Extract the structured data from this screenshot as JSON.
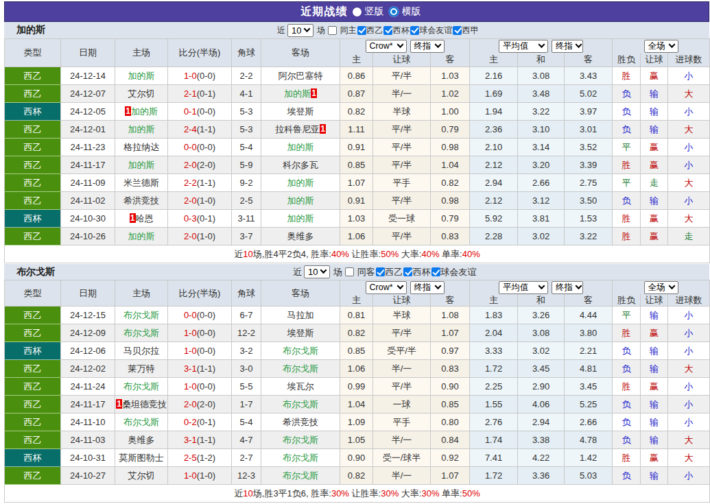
{
  "colors": {
    "purple": "#4e409e",
    "purple-border": "#2e2a66",
    "head-bg": "#dce3ec",
    "type-green": "#4a8f0e",
    "type-teal": "#086e69",
    "focus-green": "#2a9a43",
    "score-red": "#d40000",
    "res-red": "#bb0000",
    "res-blue": "#2424cc",
    "res-green": "#187a33",
    "card-red": "#e80000",
    "check-blue": "#0b79ec",
    "radio-blue": "#0e7ad8"
  },
  "title_bar": {
    "title": "近期战绩",
    "radios": [
      {
        "label": "竖版",
        "checked": false
      },
      {
        "label": "横版",
        "checked": true
      }
    ]
  },
  "table_header": {
    "left_columns": [
      "类型",
      "日期",
      "主场",
      "比分(半场)",
      "角球",
      "客场"
    ],
    "sub_columns": [
      "主",
      "让球",
      "客",
      "主",
      "和",
      "客",
      "胜负",
      "让球",
      "进球数"
    ],
    "selects": {
      "company": "Crow*",
      "company_final": "终指",
      "average": "平均值",
      "average_final": "终指",
      "full_match": "全场"
    }
  },
  "filter_labels": {
    "recent": "近",
    "count": "10",
    "matches": "场"
  },
  "sections": [
    {
      "team": "加的斯",
      "checkboxes": [
        {
          "label": "同主",
          "checked": false
        },
        {
          "label": "西乙",
          "checked": true
        },
        {
          "label": "西杯",
          "checked": true
        },
        {
          "label": "球会友谊",
          "checked": true
        },
        {
          "label": "西甲",
          "checked": true
        }
      ],
      "rows": [
        {
          "type": "西乙",
          "cup": false,
          "date": "24-12-14",
          "home": {
            "name": "加的斯",
            "focus": true
          },
          "ft": "1-0",
          "ht": "(0-0)",
          "corner": "2-2",
          "away": {
            "name": "阿尔巴塞特",
            "focus": false
          },
          "odds": [
            "0.86",
            "平/半",
            "1.03"
          ],
          "avg": [
            "2.16",
            "3.08",
            "3.43"
          ],
          "res": [
            {
              "t": "胜",
              "c": "r"
            },
            {
              "t": "赢",
              "c": "r"
            },
            {
              "t": "小",
              "c": "b"
            }
          ]
        },
        {
          "type": "西乙",
          "cup": false,
          "date": "24-12-07",
          "home": {
            "name": "艾尔切",
            "focus": false
          },
          "ft": "2-1",
          "ht": "(0-1)",
          "corner": "4-1",
          "away": {
            "name": "加的斯",
            "focus": true,
            "card": "1"
          },
          "odds": [
            "0.87",
            "半/一",
            "1.02"
          ],
          "avg": [
            "1.69",
            "3.48",
            "5.02"
          ],
          "res": [
            {
              "t": "负",
              "c": "b"
            },
            {
              "t": "输",
              "c": "b"
            },
            {
              "t": "大",
              "c": "r"
            }
          ]
        },
        {
          "type": "西杯",
          "cup": true,
          "date": "24-12-05",
          "home": {
            "name": "加的斯",
            "focus": true,
            "card": "1"
          },
          "ft": "0-1",
          "ht": "(0-0)",
          "corner": "5-3",
          "away": {
            "name": "埃登斯",
            "focus": false
          },
          "odds": [
            "0.82",
            "半球",
            "1.00"
          ],
          "avg": [
            "1.94",
            "3.22",
            "3.97"
          ],
          "res": [
            {
              "t": "负",
              "c": "b"
            },
            {
              "t": "输",
              "c": "b"
            },
            {
              "t": "小",
              "c": "b"
            }
          ]
        },
        {
          "type": "西乙",
          "cup": false,
          "date": "24-12-01",
          "home": {
            "name": "加的斯",
            "focus": true
          },
          "ft": "2-4",
          "ht": "(1-1)",
          "corner": "5-3",
          "away": {
            "name": "拉科鲁尼亚",
            "focus": false,
            "card": "1"
          },
          "odds": [
            "1.11",
            "平/半",
            "0.79"
          ],
          "avg": [
            "2.36",
            "3.10",
            "3.01"
          ],
          "res": [
            {
              "t": "负",
              "c": "b"
            },
            {
              "t": "输",
              "c": "b"
            },
            {
              "t": "大",
              "c": "r"
            }
          ]
        },
        {
          "type": "西乙",
          "cup": false,
          "date": "24-11-23",
          "home": {
            "name": "格拉纳达",
            "focus": false
          },
          "ft": "0-0",
          "ht": "(0-0)",
          "corner": "5-4",
          "away": {
            "name": "加的斯",
            "focus": true
          },
          "odds": [
            "0.91",
            "平/半",
            "0.98"
          ],
          "avg": [
            "2.10",
            "3.14",
            "3.52"
          ],
          "res": [
            {
              "t": "平",
              "c": "g"
            },
            {
              "t": "赢",
              "c": "r"
            },
            {
              "t": "小",
              "c": "b"
            }
          ]
        },
        {
          "type": "西乙",
          "cup": false,
          "date": "24-11-17",
          "home": {
            "name": "加的斯",
            "focus": true
          },
          "ft": "2-0",
          "ht": "(2-0)",
          "corner": "5-9",
          "away": {
            "name": "科尔多瓦",
            "focus": false
          },
          "odds": [
            "0.85",
            "平/半",
            "1.04"
          ],
          "avg": [
            "2.12",
            "3.20",
            "3.39"
          ],
          "res": [
            {
              "t": "胜",
              "c": "r"
            },
            {
              "t": "赢",
              "c": "r"
            },
            {
              "t": "小",
              "c": "b"
            }
          ]
        },
        {
          "type": "西乙",
          "cup": false,
          "date": "24-11-09",
          "home": {
            "name": "米兰德斯",
            "focus": false
          },
          "ft": "2-2",
          "ht": "(1-1)",
          "corner": "9-2",
          "away": {
            "name": "加的斯",
            "focus": true
          },
          "odds": [
            "1.07",
            "平手",
            "0.82"
          ],
          "avg": [
            "2.94",
            "2.66",
            "2.75"
          ],
          "res": [
            {
              "t": "平",
              "c": "g"
            },
            {
              "t": "走",
              "c": "g"
            },
            {
              "t": "大",
              "c": "r"
            }
          ]
        },
        {
          "type": "西乙",
          "cup": false,
          "date": "24-11-02",
          "home": {
            "name": "希洪竞技",
            "focus": false
          },
          "ft": "2-0",
          "ht": "(1-0)",
          "corner": "2-5",
          "away": {
            "name": "加的斯",
            "focus": true
          },
          "odds": [
            "0.91",
            "平/半",
            "0.98"
          ],
          "avg": [
            "2.12",
            "3.12",
            "3.50"
          ],
          "res": [
            {
              "t": "负",
              "c": "b"
            },
            {
              "t": "输",
              "c": "b"
            },
            {
              "t": "小",
              "c": "b"
            }
          ]
        },
        {
          "type": "西杯",
          "cup": true,
          "date": "24-10-30",
          "home": {
            "name": "哈恩",
            "focus": false,
            "card": "1"
          },
          "ft": "0-3",
          "ht": "(0-1)",
          "corner": "3-11",
          "away": {
            "name": "加的斯",
            "focus": true
          },
          "odds": [
            "1.03",
            "受一球",
            "0.79"
          ],
          "avg": [
            "5.92",
            "3.81",
            "1.53"
          ],
          "res": [
            {
              "t": "胜",
              "c": "r"
            },
            {
              "t": "赢",
              "c": "r"
            },
            {
              "t": "大",
              "c": "r"
            }
          ]
        },
        {
          "type": "西乙",
          "cup": false,
          "date": "24-10-26",
          "home": {
            "name": "加的斯",
            "focus": true
          },
          "ft": "2-0",
          "ht": "(1-0)",
          "corner": "3-7",
          "away": {
            "name": "奥维多",
            "focus": false
          },
          "odds": [
            "1.06",
            "平/半",
            "0.83"
          ],
          "avg": [
            "2.28",
            "3.02",
            "3.22"
          ],
          "res": [
            {
              "t": "胜",
              "c": "r"
            },
            {
              "t": "赢",
              "c": "r"
            },
            {
              "t": "走",
              "c": "g"
            }
          ]
        }
      ],
      "summary": [
        {
          "t": "近"
        },
        {
          "t": "10",
          "red": true
        },
        {
          "t": "场,胜4平2负4, 胜率:"
        },
        {
          "t": "40%",
          "red": true
        },
        {
          "t": " 让胜率:"
        },
        {
          "t": "50%",
          "red": true
        },
        {
          "t": " 大率:"
        },
        {
          "t": "40%",
          "red": true
        },
        {
          "t": " 单率:"
        },
        {
          "t": "40%",
          "red": true
        }
      ]
    },
    {
      "team": "布尔戈斯",
      "checkboxes": [
        {
          "label": "同客",
          "checked": false
        },
        {
          "label": "西乙",
          "checked": true
        },
        {
          "label": "西杯",
          "checked": true
        },
        {
          "label": "球会友谊",
          "checked": true
        }
      ],
      "rows": [
        {
          "type": "西乙",
          "cup": false,
          "date": "24-12-15",
          "home": {
            "name": "布尔戈斯",
            "focus": true
          },
          "ft": "0-0",
          "ht": "(0-0)",
          "corner": "6-7",
          "away": {
            "name": "马拉加",
            "focus": false
          },
          "odds": [
            "0.81",
            "半球",
            "1.08"
          ],
          "avg": [
            "1.83",
            "3.26",
            "4.44"
          ],
          "res": [
            {
              "t": "平",
              "c": "g"
            },
            {
              "t": "输",
              "c": "b"
            },
            {
              "t": "小",
              "c": "b"
            }
          ]
        },
        {
          "type": "西乙",
          "cup": false,
          "date": "24-12-09",
          "home": {
            "name": "布尔戈斯",
            "focus": true
          },
          "ft": "1-0",
          "ht": "(0-0)",
          "corner": "12-2",
          "away": {
            "name": "埃登斯",
            "focus": false
          },
          "odds": [
            "0.82",
            "平/半",
            "1.07"
          ],
          "avg": [
            "2.04",
            "3.08",
            "3.80"
          ],
          "res": [
            {
              "t": "胜",
              "c": "r"
            },
            {
              "t": "赢",
              "c": "r"
            },
            {
              "t": "小",
              "c": "b"
            }
          ]
        },
        {
          "type": "西杯",
          "cup": true,
          "date": "24-12-06",
          "home": {
            "name": "马贝尔拉",
            "focus": false
          },
          "ft": "1-0",
          "ht": "(0-0)",
          "corner": "3-2",
          "away": {
            "name": "布尔戈斯",
            "focus": true
          },
          "odds": [
            "0.85",
            "受平/半",
            "0.97"
          ],
          "avg": [
            "3.33",
            "3.02",
            "2.21"
          ],
          "res": [
            {
              "t": "负",
              "c": "b"
            },
            {
              "t": "输",
              "c": "b"
            },
            {
              "t": "小",
              "c": "b"
            }
          ]
        },
        {
          "type": "西乙",
          "cup": false,
          "date": "24-12-02",
          "home": {
            "name": "莱万特",
            "focus": false
          },
          "ft": "3-1",
          "ht": "(1-1)",
          "corner": "3-0",
          "away": {
            "name": "布尔戈斯",
            "focus": true
          },
          "odds": [
            "1.06",
            "半/一",
            "0.83"
          ],
          "avg": [
            "1.72",
            "3.45",
            "4.81"
          ],
          "res": [
            {
              "t": "负",
              "c": "b"
            },
            {
              "t": "输",
              "c": "b"
            },
            {
              "t": "大",
              "c": "r"
            }
          ]
        },
        {
          "type": "西乙",
          "cup": false,
          "date": "24-11-24",
          "home": {
            "name": "布尔戈斯",
            "focus": true
          },
          "ft": "1-0",
          "ht": "(0-0)",
          "corner": "5-5",
          "away": {
            "name": "埃瓦尔",
            "focus": false
          },
          "odds": [
            "0.99",
            "平/半",
            "0.90"
          ],
          "avg": [
            "2.25",
            "2.90",
            "3.45"
          ],
          "res": [
            {
              "t": "胜",
              "c": "r"
            },
            {
              "t": "赢",
              "c": "r"
            },
            {
              "t": "小",
              "c": "b"
            }
          ]
        },
        {
          "type": "西乙",
          "cup": false,
          "date": "24-11-17",
          "home": {
            "name": "桑坦德竞技",
            "focus": false,
            "card": "1"
          },
          "ft": "2-0",
          "ht": "(2-0)",
          "corner": "1-7",
          "away": {
            "name": "布尔戈斯",
            "focus": true
          },
          "odds": [
            "1.04",
            "一球",
            "0.85"
          ],
          "avg": [
            "1.55",
            "4.06",
            "5.25"
          ],
          "res": [
            {
              "t": "负",
              "c": "b"
            },
            {
              "t": "输",
              "c": "b"
            },
            {
              "t": "小",
              "c": "b"
            }
          ]
        },
        {
          "type": "西乙",
          "cup": false,
          "date": "24-11-10",
          "home": {
            "name": "布尔戈斯",
            "focus": true
          },
          "ft": "0-2",
          "ht": "(0-1)",
          "corner": "5-4",
          "away": {
            "name": "希洪竞技",
            "focus": false
          },
          "odds": [
            "1.09",
            "平手",
            "0.80"
          ],
          "avg": [
            "2.76",
            "2.94",
            "2.66"
          ],
          "res": [
            {
              "t": "负",
              "c": "b"
            },
            {
              "t": "输",
              "c": "b"
            },
            {
              "t": "小",
              "c": "b"
            }
          ]
        },
        {
          "type": "西乙",
          "cup": false,
          "date": "24-11-03",
          "home": {
            "name": "奥维多",
            "focus": false
          },
          "ft": "3-1",
          "ht": "(1-1)",
          "corner": "4-7",
          "away": {
            "name": "布尔戈斯",
            "focus": true
          },
          "odds": [
            "1.05",
            "半/一",
            "0.84"
          ],
          "avg": [
            "1.74",
            "3.38",
            "4.78"
          ],
          "res": [
            {
              "t": "负",
              "c": "b"
            },
            {
              "t": "输",
              "c": "b"
            },
            {
              "t": "大",
              "c": "r"
            }
          ]
        },
        {
          "type": "西杯",
          "cup": true,
          "date": "24-10-31",
          "home": {
            "name": "莫斯图勒士",
            "focus": false
          },
          "ft": "2-5",
          "ht": "(1-2)",
          "corner": "2-7",
          "away": {
            "name": "布尔戈斯",
            "focus": true
          },
          "odds": [
            "0.90",
            "受一/球半",
            "0.92"
          ],
          "avg": [
            "7.41",
            "4.22",
            "1.42"
          ],
          "res": [
            {
              "t": "胜",
              "c": "r"
            },
            {
              "t": "赢",
              "c": "r"
            },
            {
              "t": "大",
              "c": "r"
            }
          ]
        },
        {
          "type": "西乙",
          "cup": false,
          "date": "24-10-27",
          "home": {
            "name": "艾尔切",
            "focus": false
          },
          "ft": "1-0",
          "ht": "(1-0)",
          "corner": "12-3",
          "away": {
            "name": "布尔戈斯",
            "focus": true
          },
          "odds": [
            "0.82",
            "半/一",
            "1.07"
          ],
          "avg": [
            "1.72",
            "3.36",
            "5.03"
          ],
          "res": [
            {
              "t": "负",
              "c": "b"
            },
            {
              "t": "输",
              "c": "b"
            },
            {
              "t": "小",
              "c": "b"
            }
          ]
        }
      ],
      "summary": [
        {
          "t": "近"
        },
        {
          "t": "10",
          "red": true
        },
        {
          "t": "场,胜3平1负6, 胜率:"
        },
        {
          "t": "30%",
          "red": true
        },
        {
          "t": " 让胜率:"
        },
        {
          "t": "30%",
          "red": true
        },
        {
          "t": " 大率:"
        },
        {
          "t": "30%",
          "red": true
        },
        {
          "t": " 单率:"
        },
        {
          "t": "50%",
          "red": true
        }
      ]
    }
  ]
}
